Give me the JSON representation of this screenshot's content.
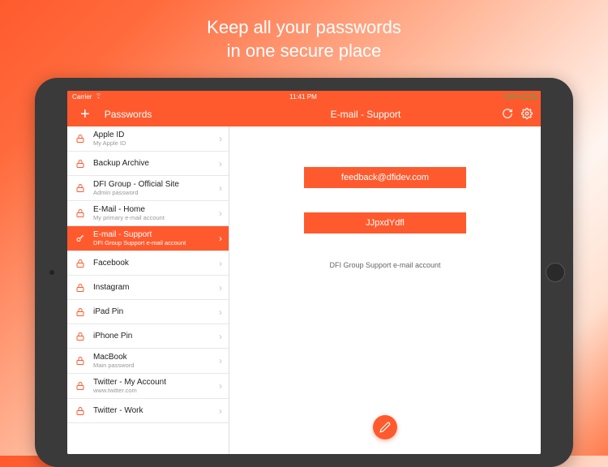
{
  "hero": {
    "line1": "Keep all your passwords",
    "line2": "in one secure place"
  },
  "statusbar": {
    "carrier": "Carrier",
    "time": "11:41 PM",
    "battery": "100%"
  },
  "navbar": {
    "list_title": "Passwords",
    "detail_title": "E-mail - Support"
  },
  "list": [
    {
      "name": "Apple ID",
      "sub": "My Apple ID",
      "selected": false
    },
    {
      "name": "Backup Archive",
      "sub": "",
      "selected": false
    },
    {
      "name": "DFI Group - Official Site",
      "sub": "Admin password",
      "selected": false
    },
    {
      "name": "E-Mail - Home",
      "sub": "My primary e-mail account",
      "selected": false
    },
    {
      "name": "E-mail - Support",
      "sub": "DFI Group Support e-mail account",
      "selected": true
    },
    {
      "name": "Facebook",
      "sub": "",
      "selected": false
    },
    {
      "name": "Instagram",
      "sub": "",
      "selected": false
    },
    {
      "name": "iPad Pin",
      "sub": "",
      "selected": false
    },
    {
      "name": "iPhone Pin",
      "sub": "",
      "selected": false
    },
    {
      "name": "MacBook",
      "sub": "Main password",
      "selected": false
    },
    {
      "name": "Twitter - My Account",
      "sub": "www.twitter.com",
      "selected": false
    },
    {
      "name": "Twitter - Work",
      "sub": "",
      "selected": false
    }
  ],
  "detail": {
    "username": "feedback@dfidev.com",
    "password": "JJpxdYdfl",
    "description": "DFI Group Support e-mail account"
  },
  "colors": {
    "accent": "#ff5a2e"
  }
}
